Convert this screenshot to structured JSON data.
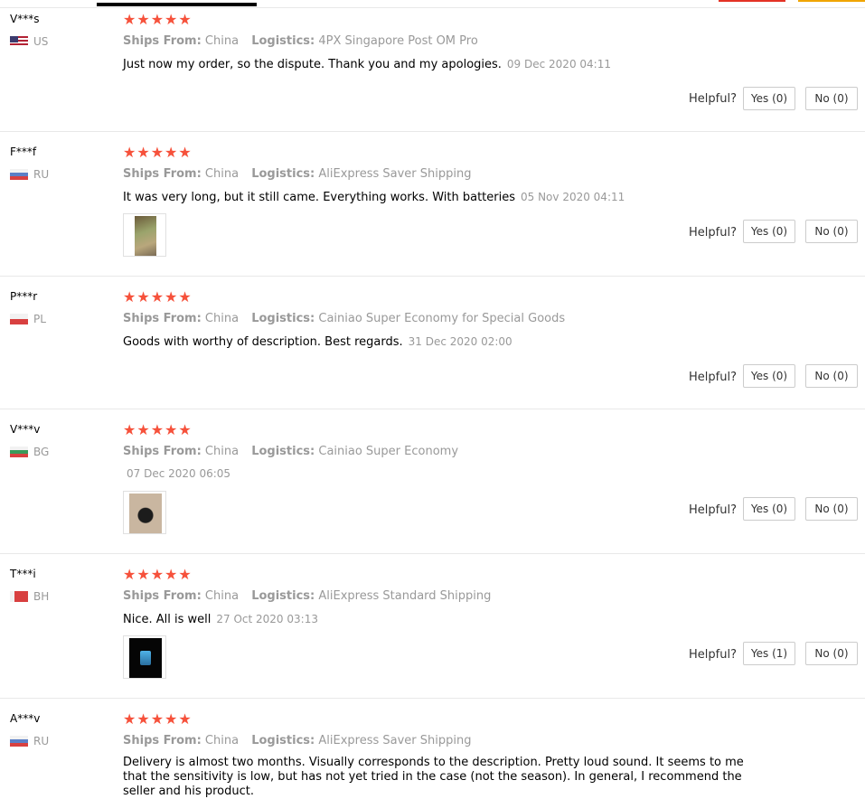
{
  "labels": {
    "ships_from": "Ships From:",
    "logistics": "Logistics:",
    "helpful": "Helpful?",
    "stars": "★★★★★"
  },
  "colors": {
    "star": "#f6513b",
    "meta": "#999999"
  },
  "reviews": [
    {
      "user": "V***s",
      "country": "US",
      "ships_from": "China",
      "logistics": "4PX Singapore Post OM Pro",
      "text": "Just now my order, so the dispute. Thank you and my apologies.",
      "date": "09 Dec 2020 04:11",
      "yes": "Yes (0)",
      "no": "No (0)",
      "has_image": false
    },
    {
      "user": "F***f",
      "country": "RU",
      "ships_from": "China",
      "logistics": "AliExpress Saver Shipping",
      "text": "It was very long, but it still came. Everything works. With batteries",
      "date": "05 Nov 2020 04:11",
      "yes": "Yes (0)",
      "no": "No (0)",
      "has_image": true
    },
    {
      "user": "P***r",
      "country": "PL",
      "ships_from": "China",
      "logistics": "Cainiao Super Economy for Special Goods",
      "text": "Goods with worthy of description. Best regards.",
      "date": "31 Dec 2020 02:00",
      "yes": "Yes (0)",
      "no": "No (0)",
      "has_image": false
    },
    {
      "user": "V***v",
      "country": "BG",
      "ships_from": "China",
      "logistics": "Cainiao Super Economy",
      "text": "",
      "date": "07 Dec 2020 06:05",
      "yes": "Yes (0)",
      "no": "No (0)",
      "has_image": true
    },
    {
      "user": "T***i",
      "country": "BH",
      "ships_from": "China",
      "logistics": "AliExpress Standard Shipping",
      "text": "Nice. All is well",
      "date": "27 Oct 2020 03:13",
      "yes": "Yes (1)",
      "no": "No (0)",
      "has_image": true
    },
    {
      "user": "A***v",
      "country": "RU",
      "ships_from": "China",
      "logistics": "AliExpress Saver Shipping",
      "text": "Delivery is almost two months. Visually corresponds to the description. Pretty loud sound. It seems to me that the sensitivity is low, but has not yet tried in the case (not the season). In general, I recommend the seller and his product.",
      "date": "",
      "yes": "",
      "no": "",
      "has_image": false
    }
  ]
}
